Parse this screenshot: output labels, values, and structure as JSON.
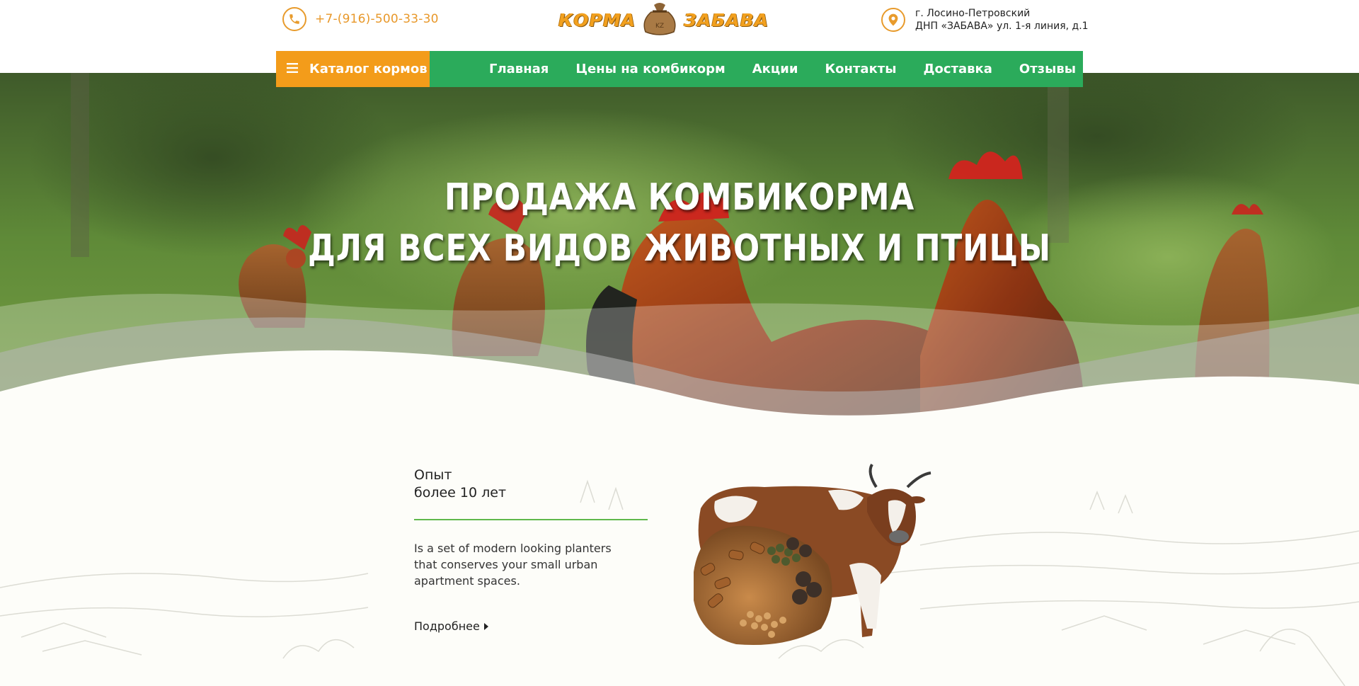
{
  "header": {
    "phone": "+7-(916)-500-33-30",
    "logo": {
      "left_word": "КОРМА",
      "right_word": "ЗАБАВА"
    },
    "address_line1": "г. Лосино-Петровский",
    "address_line2": "ДНП «ЗАБАВА» ул. 1-я линия, д.1"
  },
  "nav": {
    "catalog_label": "Каталог кормов",
    "items": [
      "Главная",
      "Цены на комбикорм",
      "Акции",
      "Контакты",
      "Доставка",
      "Отзывы"
    ]
  },
  "hero": {
    "title_line1": "ПРОДАЖА КОМБИКОРМА",
    "title_line2": "ДЛЯ ВСЕХ ВИДОВ ЖИВОТНЫХ И ПТИЦЫ"
  },
  "feature": {
    "title_line1": "Опыт",
    "title_line2": "более 10 лет",
    "text": "Is a set of modern looking planters that conserves your small urban apartment spaces.",
    "more_label": "Подробнее"
  },
  "colors": {
    "orange": "#f39c1a",
    "green": "#2bab5b",
    "accent_line": "#5fb84c",
    "phone_text": "#e8982a"
  },
  "icons": [
    "phone-icon",
    "location-pin-icon",
    "menu-icon",
    "caret-right-icon",
    "feed-bag-icon"
  ]
}
